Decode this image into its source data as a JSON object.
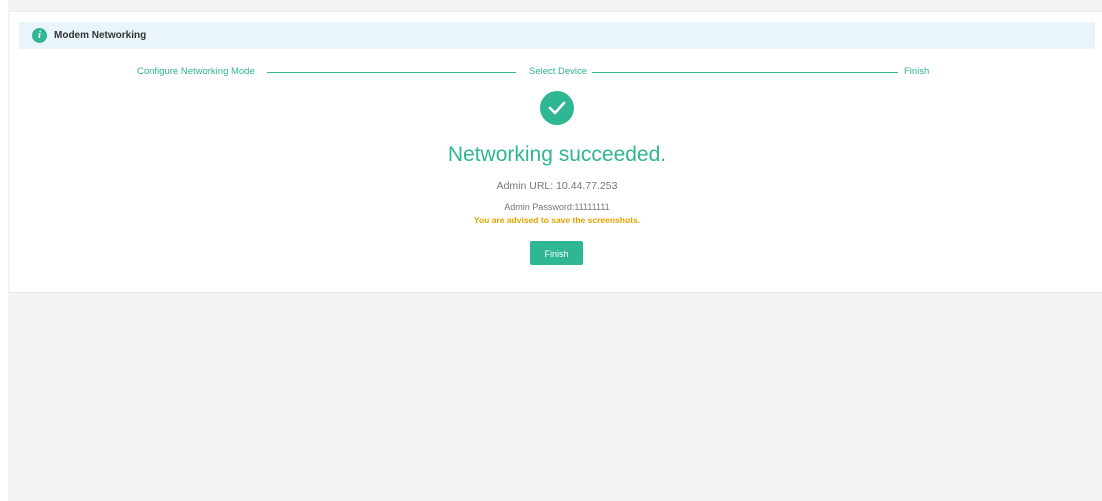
{
  "header": {
    "icon": "info-icon",
    "icon_glyph": "i",
    "title": "Modem Networking"
  },
  "steps": [
    {
      "label": "Configure Networking Mode"
    },
    {
      "label": "Select Device"
    },
    {
      "label": "Finish"
    }
  ],
  "result": {
    "icon": "check-circle-icon",
    "title": "Networking succeeded.",
    "admin_url": "Admin URL: 10.44.77.253",
    "admin_password": "Admin Password:11111111",
    "advice": "You are advised to save the screenshots."
  },
  "actions": {
    "finish_label": "Finish"
  },
  "colors": {
    "accent": "#2fb693",
    "warning": "#e6a100",
    "header_bg": "#eaf4fb",
    "page_bg": "#f3f3f3"
  }
}
